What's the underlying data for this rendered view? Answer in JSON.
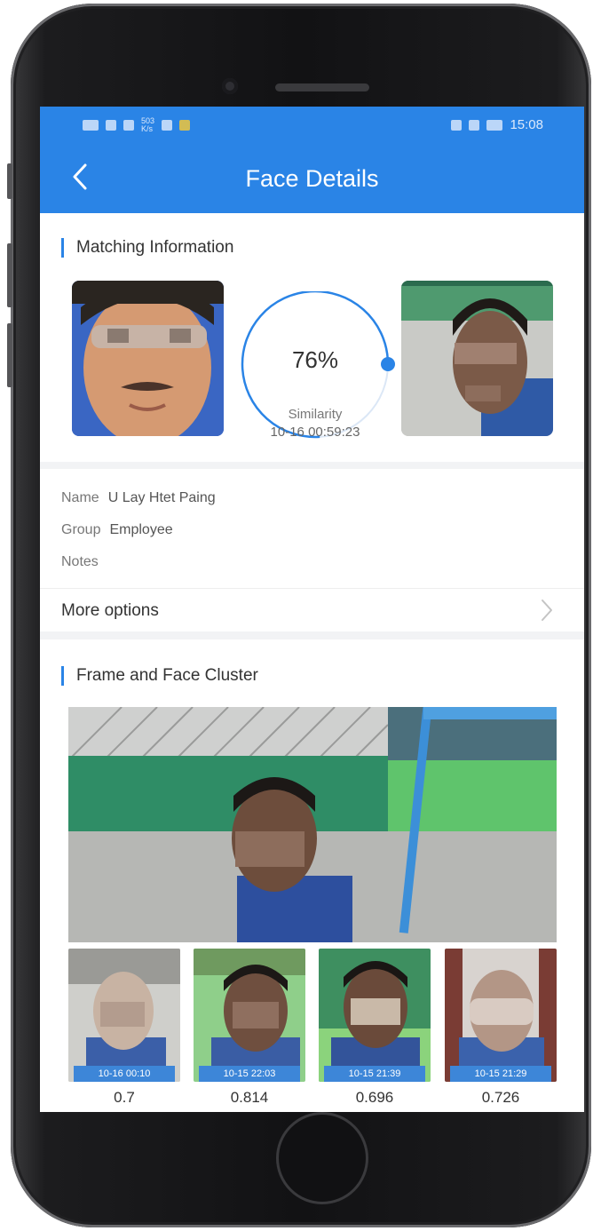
{
  "status_bar": {
    "time": "15:08",
    "speed": "503",
    "speed_unit": "K/s"
  },
  "header": {
    "title": "Face Details",
    "back_icon": "chevron-left-icon"
  },
  "matching": {
    "section_title": "Matching Information",
    "similarity_value": "76%",
    "similarity_fraction": 0.76,
    "similarity_label": "Similarity",
    "timestamp": "10-16 00:59:23"
  },
  "person": {
    "name_label": "Name",
    "name_value": "U Lay Htet Paing",
    "group_label": "Group",
    "group_value": "Employee",
    "notes_label": "Notes",
    "notes_value": ""
  },
  "more_options": {
    "label": "More options",
    "icon": "chevron-right-icon"
  },
  "cluster": {
    "section_title": "Frame and Face Cluster",
    "thumbnails": [
      {
        "time": "10-16 00:10",
        "score": "0.7"
      },
      {
        "time": "10-15 22:03",
        "score": "0.814"
      },
      {
        "time": "10-15 21:39",
        "score": "0.696"
      },
      {
        "time": "10-15 21:29",
        "score": "0.726"
      }
    ]
  },
  "colors": {
    "accent": "#2a84e6",
    "background": "#f2f3f5"
  }
}
